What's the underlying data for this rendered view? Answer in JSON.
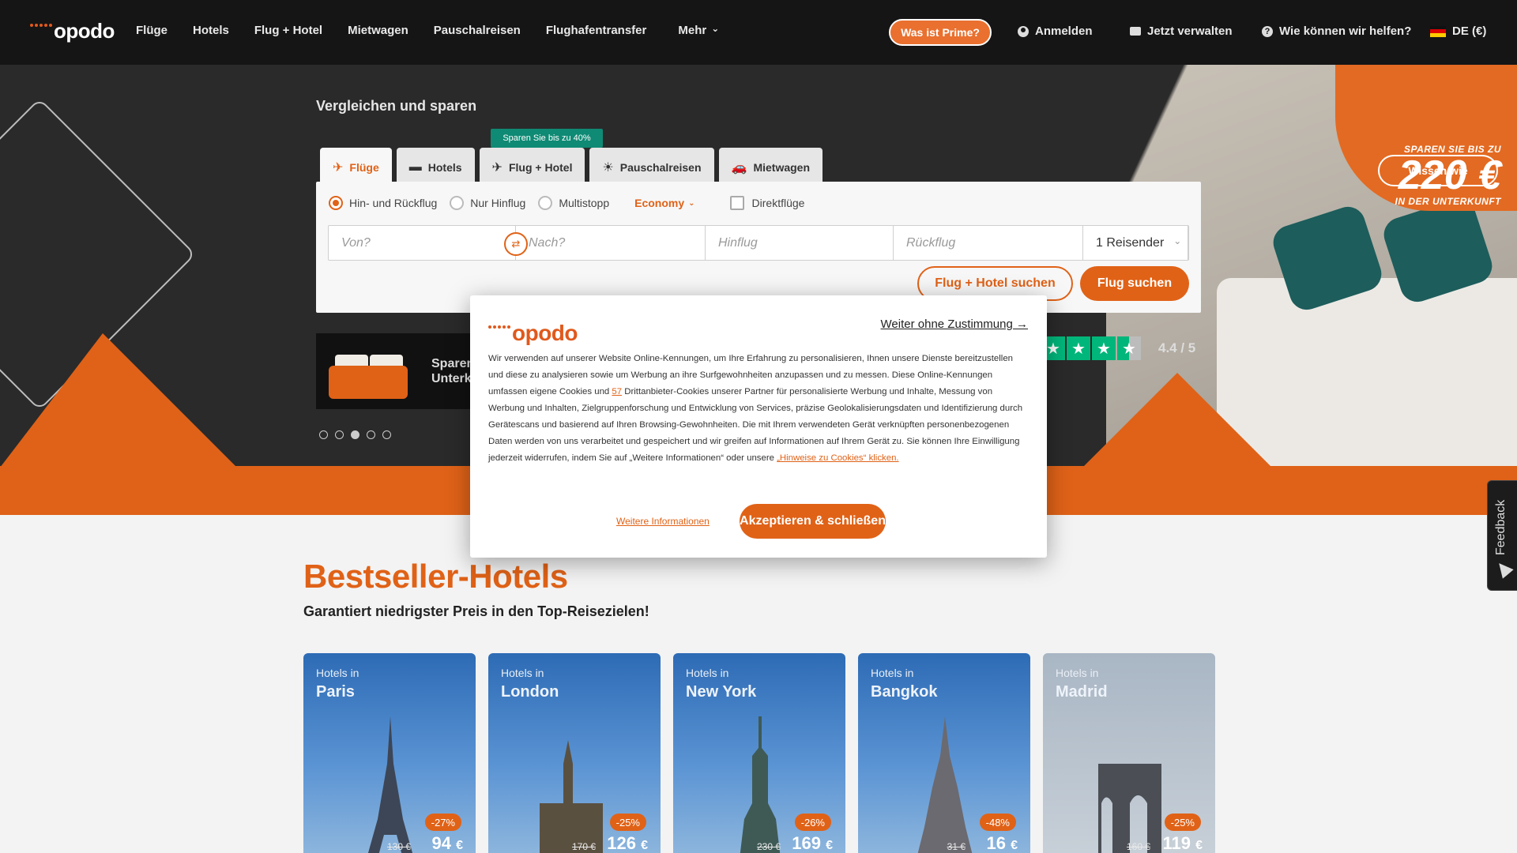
{
  "header": {
    "logo": "opodo",
    "nav": [
      "Flüge",
      "Hotels",
      "Flug + Hotel",
      "Mietwagen",
      "Pauschalreisen",
      "Flughafentransfer",
      "Mehr"
    ],
    "prime_button": "Was ist Prime?",
    "login": "Anmelden",
    "manage": "Jetzt verwalten",
    "help": "Wie können wir helfen?",
    "locale": "DE (€)"
  },
  "hero": {
    "title": "Vergleichen und sparen",
    "promo": {
      "top": "SPAREN SIE BIS ZU",
      "amount": "220 €",
      "bottom": "IN DER UNTERKUNFT",
      "button": "Wissen wie"
    },
    "hotel_card_text": "Sparen Unterkü",
    "carousel": {
      "count": 5,
      "active": 3
    },
    "trustpilot": {
      "score": "4.4 / 5"
    }
  },
  "search": {
    "tab_badge": "Sparen Sie bis zu 40%",
    "tabs": [
      {
        "label": "Flüge",
        "icon": "plane-icon"
      },
      {
        "label": "Hotels",
        "icon": "bed-icon"
      },
      {
        "label": "Flug + Hotel",
        "icon": "plane-bed-icon"
      },
      {
        "label": "Pauschalreisen",
        "icon": "sun-icon"
      },
      {
        "label": "Mietwagen",
        "icon": "car-icon"
      }
    ],
    "trip_types": [
      "Hin- und Rückflug",
      "Nur Hinflug",
      "Multistopp"
    ],
    "cabin_class": "Economy",
    "direct_flights": "Direktflüge",
    "from_placeholder": "Von?",
    "to_placeholder": "Nach?",
    "depart_placeholder": "Hinflug",
    "return_placeholder": "Rückflug",
    "travelers": "1 Reisender",
    "btn_flight_hotel": "Flug + Hotel suchen",
    "btn_flight": "Flug suchen"
  },
  "feedback": "Feedback",
  "bestseller": {
    "title": "Bestseller-Hotels",
    "subtitle": "Garantiert niedrigster Preis in den Top-Reisezielen!",
    "prefix": "Hotels in",
    "cards": [
      {
        "city": "Paris",
        "discount": "-27%",
        "old": "130 €",
        "price": "94",
        "cur": "€"
      },
      {
        "city": "London",
        "discount": "-25%",
        "old": "170 €",
        "price": "126",
        "cur": "€"
      },
      {
        "city": "New York",
        "discount": "-26%",
        "old": "230 €",
        "price": "169",
        "cur": "€"
      },
      {
        "city": "Bangkok",
        "discount": "-48%",
        "old": "31 €",
        "price": "16",
        "cur": "€"
      },
      {
        "city": "Madrid",
        "discount": "-25%",
        "old": "160 €",
        "price": "119",
        "cur": "€"
      }
    ]
  },
  "cookie": {
    "logo": "opodo",
    "skip": "Weiter ohne Zustimmung →",
    "text_1": "Wir verwenden auf unserer Website Online-Kennungen, um Ihre Erfahrung zu personalisieren, Ihnen unsere Dienste bereitzustellen und diese zu analysieren sowie um Werbung an ihre Surfgewohnheiten anzupassen und zu messen. Diese Online-Kennungen umfassen eigene Cookies und ",
    "partners_count": "57",
    "text_2": " Drittanbieter-Cookies unserer Partner für personalisierte Werbung und Inhalte, Messung von Werbung und Inhalten, Zielgruppenforschung und Entwicklung von Services, präzise Geolokalisierungsdaten und Identifizierung durch Gerätescans und basierend auf Ihren Browsing-Gewohnheiten. Die mit Ihrem verwendeten Gerät verknüpften personenbezogenen Daten werden von uns verarbeitet und gespeichert und wir greifen auf Informationen auf Ihrem Gerät zu. Sie können Ihre Einwilligung jederzeit widerrufen, indem Sie auf „Weitere Informationen“ oder unsere ",
    "link": "„Hinweise zu Cookies“ klicken.",
    "more": "Weitere Informationen",
    "accept": "Akzeptieren & schließen"
  },
  "colors": {
    "brand": "#e06217",
    "dark": "#151515",
    "teal": "#0f8a74"
  }
}
